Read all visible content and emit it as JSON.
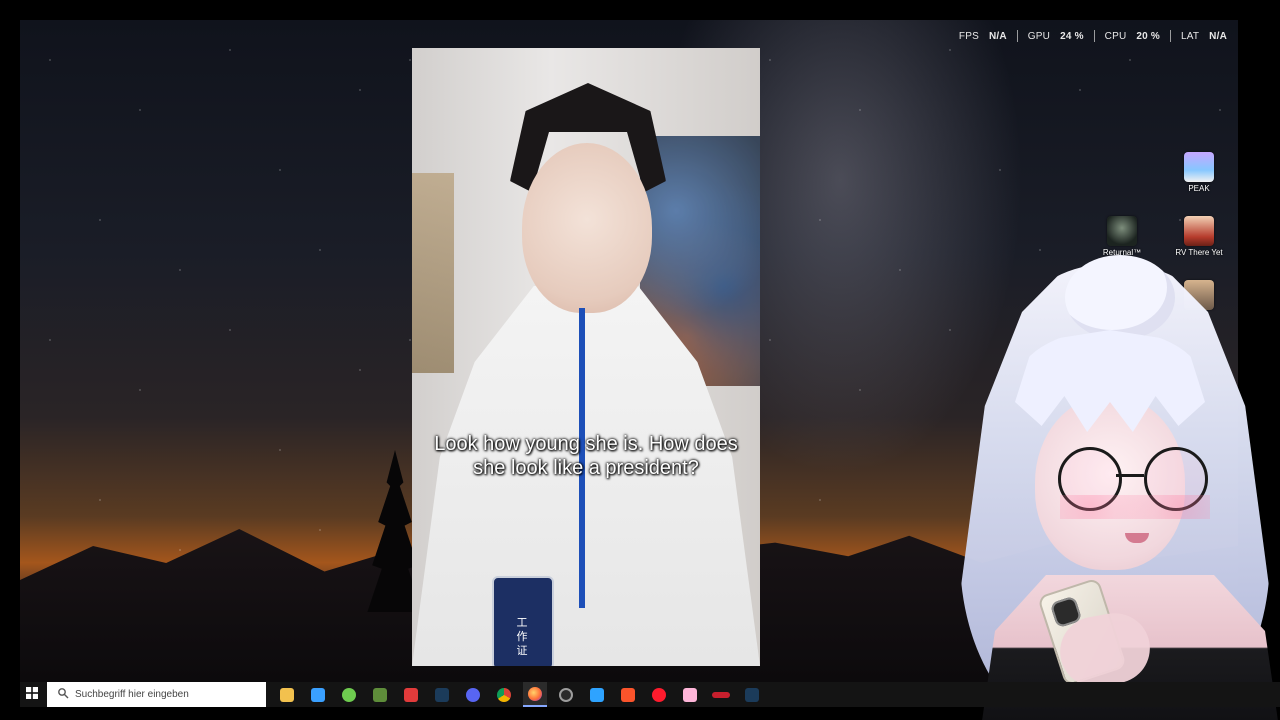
{
  "overlay": {
    "fps_label": "FPS",
    "fps_value": "N/A",
    "gpu_label": "GPU",
    "gpu_value": "24 %",
    "cpu_label": "CPU",
    "cpu_value": "20 %",
    "lat_label": "LAT",
    "lat_value": "N/A"
  },
  "video": {
    "subtitle": "Look how young she is. How does she look like a president?",
    "badge_text": "工作证"
  },
  "desktop": {
    "icons": [
      {
        "label": "PEAK",
        "icon": "peak-game-icon"
      },
      {
        "label": "Returnal™",
        "icon": "returnal-game-icon"
      },
      {
        "label": "RV There Yet",
        "icon": "rv-there-yet-game-icon"
      }
    ]
  },
  "taskbar": {
    "search_placeholder": "Suchbegriff hier eingeben",
    "apps": [
      {
        "name": "file-explorer",
        "color": "#f2c14e"
      },
      {
        "name": "microsoft-store",
        "color": "#3aa0ff"
      },
      {
        "name": "android-app",
        "color": "#6ecb4f"
      },
      {
        "name": "minecraft",
        "color": "#5e8d3a"
      },
      {
        "name": "battle-net",
        "color": "#e23b3b"
      },
      {
        "name": "steam",
        "color": "#1b3b5a"
      },
      {
        "name": "discord",
        "color": "#5865f2"
      },
      {
        "name": "chrome",
        "color": "#f4b400"
      },
      {
        "name": "firefox",
        "color": "#ff7139"
      },
      {
        "name": "obs",
        "color": "#2b2b2b"
      },
      {
        "name": "generic-blue-app",
        "color": "#2ea3ff"
      },
      {
        "name": "brave",
        "color": "#fb542b"
      },
      {
        "name": "opera",
        "color": "#ff1b2d"
      },
      {
        "name": "image-viewer",
        "color": "#ffb6d9"
      },
      {
        "name": "generic-red-app",
        "color": "#c71f2d"
      },
      {
        "name": "steam-2",
        "color": "#1b3b5a"
      }
    ]
  }
}
